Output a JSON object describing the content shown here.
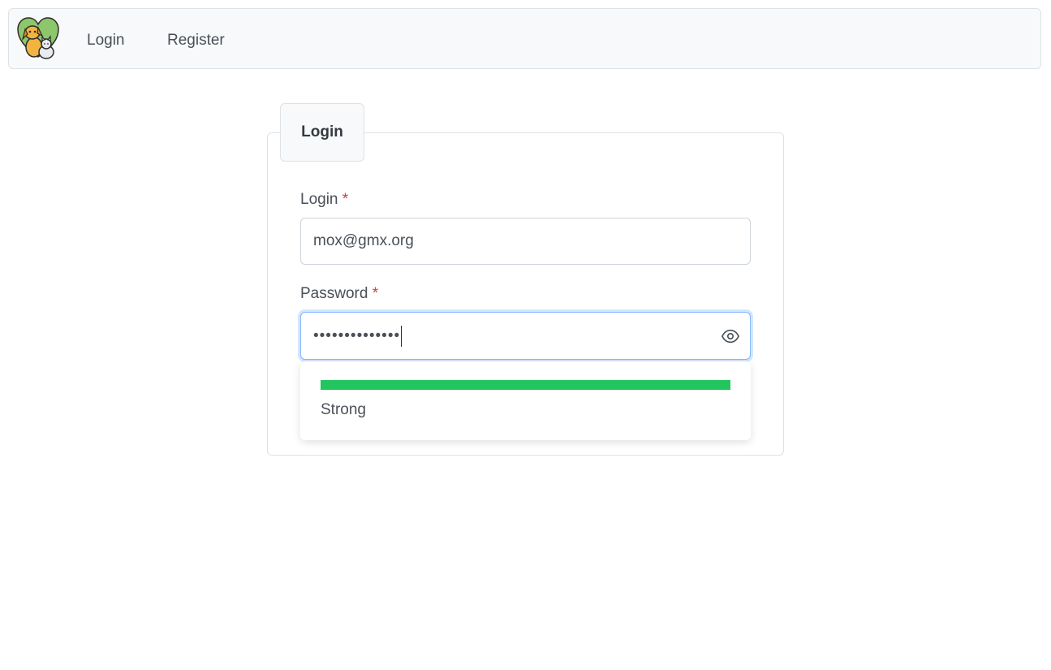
{
  "nav": {
    "logo_name": "dog-cat-logo",
    "items": [
      {
        "label": "Login"
      },
      {
        "label": "Register"
      }
    ]
  },
  "form": {
    "legend": "Login",
    "login_label": "Login",
    "login_required": "*",
    "login_value": "mox@gmx.org",
    "password_label": "Password",
    "password_required": "*",
    "password_masked": "••••••••••••••",
    "password_toggle_icon": "eye-icon",
    "strength": {
      "label": "Strong",
      "level": 1.0,
      "color": "#22c55e"
    }
  },
  "colors": {
    "required": "#dc3545",
    "focus_border": "#86b7fe"
  }
}
